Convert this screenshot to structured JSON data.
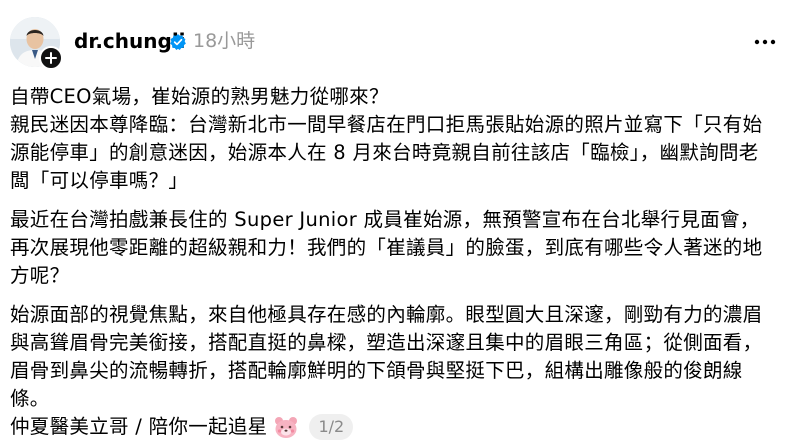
{
  "post": {
    "username": "dr.chungli",
    "timestamp": "18小時",
    "paragraphs": [
      "自帶CEO氣場，崔始源的熟男魅力從哪來？\n親民迷因本尊降臨：台灣新北市一間早餐店在門口拒馬張貼始源的照片並寫下「只有始源能停車」的創意迷因，始源本人在 8 月來台時竟親自前往該店「臨檢」，幽默詢問老闆「可以停車嗎？」",
      "最近在台灣拍戲兼長住的 Super Junior 成員崔始源，無預警宣布在台北舉行見面會，再次展現他零距離的超級親和力！我們的「崔議員」的臉蛋，到底有哪些令人著迷的地方呢？",
      "始源面部的視覺焦點，來自他極具存在感的內輪廓。眼型圓大且深邃，剛勁有力的濃眉與高聳眉骨完美銜接，搭配直挺的鼻樑，塑造出深邃且集中的眉眼三角區；從側面看，眉骨到鼻尖的流暢轉折，搭配輪廓鮮明的下頜骨與堅挺下巴，組構出雕像般的俊朗線條。"
    ],
    "signature": "仲夏醫美立哥 / 陪你一起追星",
    "page_indicator": "1/2"
  },
  "icons": {
    "verified": "verified-badge-icon",
    "more": "more-options-icon",
    "follow": "plus-icon",
    "bear": "bear-emoji-icon"
  },
  "colors": {
    "text": "#000000",
    "secondary": "#999999",
    "verified": "#0095f6",
    "pill_bg": "#efefef"
  }
}
